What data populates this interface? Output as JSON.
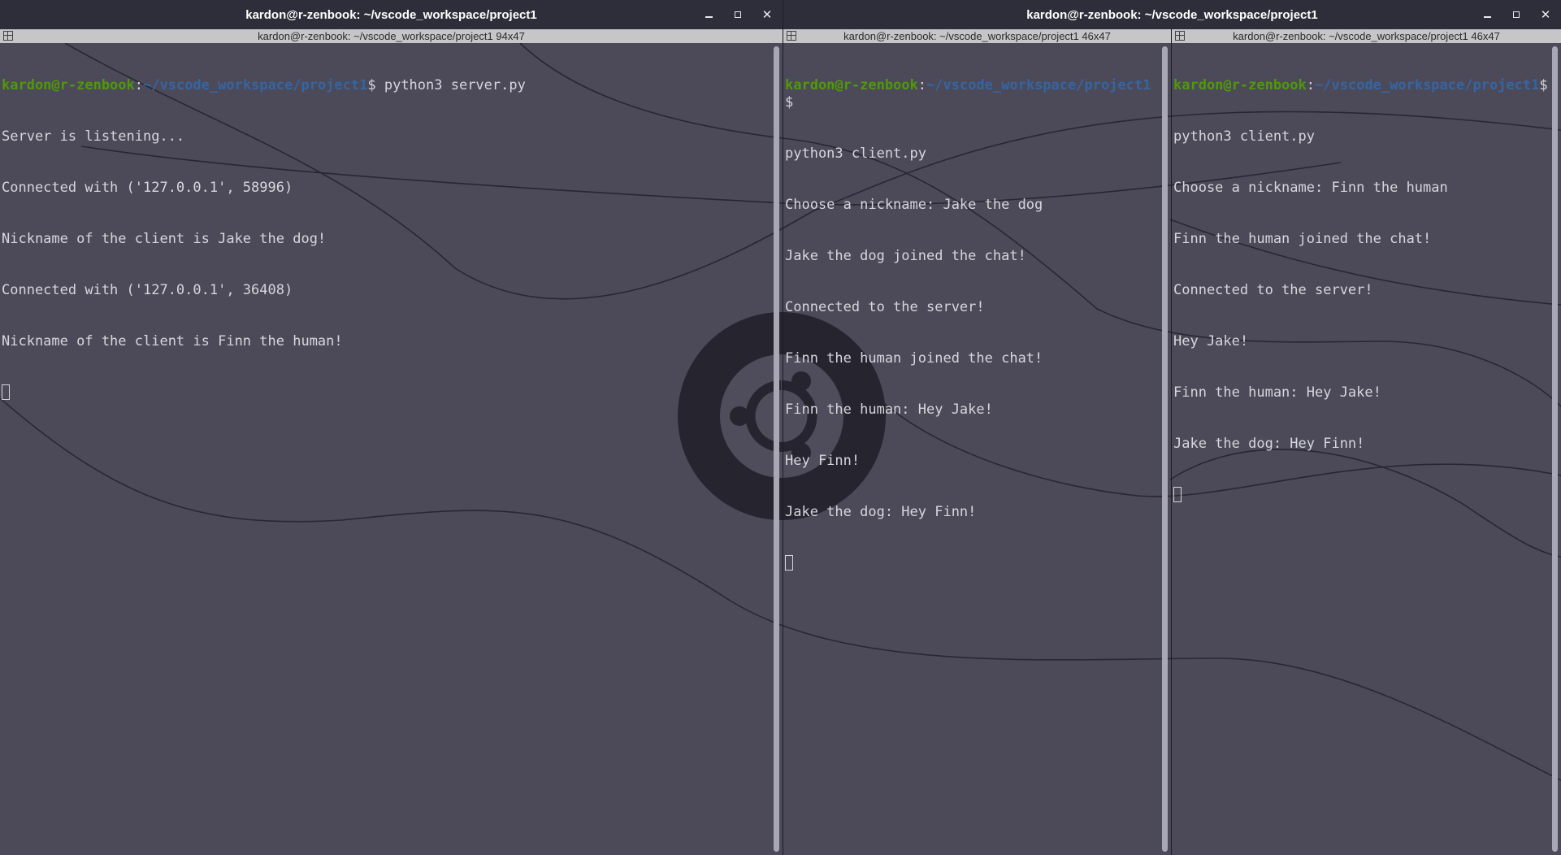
{
  "windows": {
    "left": {
      "title": "kardon@r-zenbook: ~/vscode_workspace/project1",
      "pane": {
        "header": "kardon@r-zenbook: ~/vscode_workspace/project1 94x47",
        "prompt_user": "kardon@r-zenbook",
        "prompt_sep": ":",
        "prompt_path": "~/vscode_workspace/project1",
        "prompt_end": "$ ",
        "command": "python3 server.py",
        "output": [
          "Server is listening...",
          "Connected with ('127.0.0.1', 58996)",
          "Nickname of the client is Jake the dog!",
          "Connected with ('127.0.0.1', 36408)",
          "Nickname of the client is Finn the human!"
        ]
      }
    },
    "right": {
      "title": "kardon@r-zenbook: ~/vscode_workspace/project1",
      "panes": [
        {
          "header": "kardon@r-zenbook: ~/vscode_workspace/project1 46x47",
          "prompt_user": "kardon@r-zenbook",
          "prompt_sep": ":",
          "prompt_path": "~/vscode_workspace/project1",
          "prompt_end": "$",
          "command": "python3 client.py",
          "output": [
            "Choose a nickname: Jake the dog",
            "Jake the dog joined the chat!",
            "Connected to the server!",
            "Finn the human joined the chat!",
            "Finn the human: Hey Jake!",
            "Hey Finn!",
            "Jake the dog: Hey Finn!"
          ]
        },
        {
          "header": "kardon@r-zenbook: ~/vscode_workspace/project1 46x47",
          "prompt_user": "kardon@r-zenbook",
          "prompt_sep": ":",
          "prompt_path": "~/vscode_workspace/project1",
          "prompt_end": "$",
          "command": "python3 client.py",
          "output": [
            "Choose a nickname: Finn the human",
            "Finn the human joined the chat!",
            "Connected to the server!",
            "Hey Jake!",
            "Finn the human: Hey Jake!",
            "Jake the dog: Hey Finn!"
          ]
        }
      ]
    }
  },
  "wm_icons": [
    "minimize-icon",
    "maximize-icon",
    "close-icon"
  ],
  "colors": {
    "background": "#4c4a59",
    "titlebar": "#2e2e3a",
    "pane_header": "#c6c5c8",
    "text": "#d6d6dc",
    "prompt_user": "#4e9a06",
    "prompt_path": "#3465a4",
    "logo": "#26242f"
  }
}
